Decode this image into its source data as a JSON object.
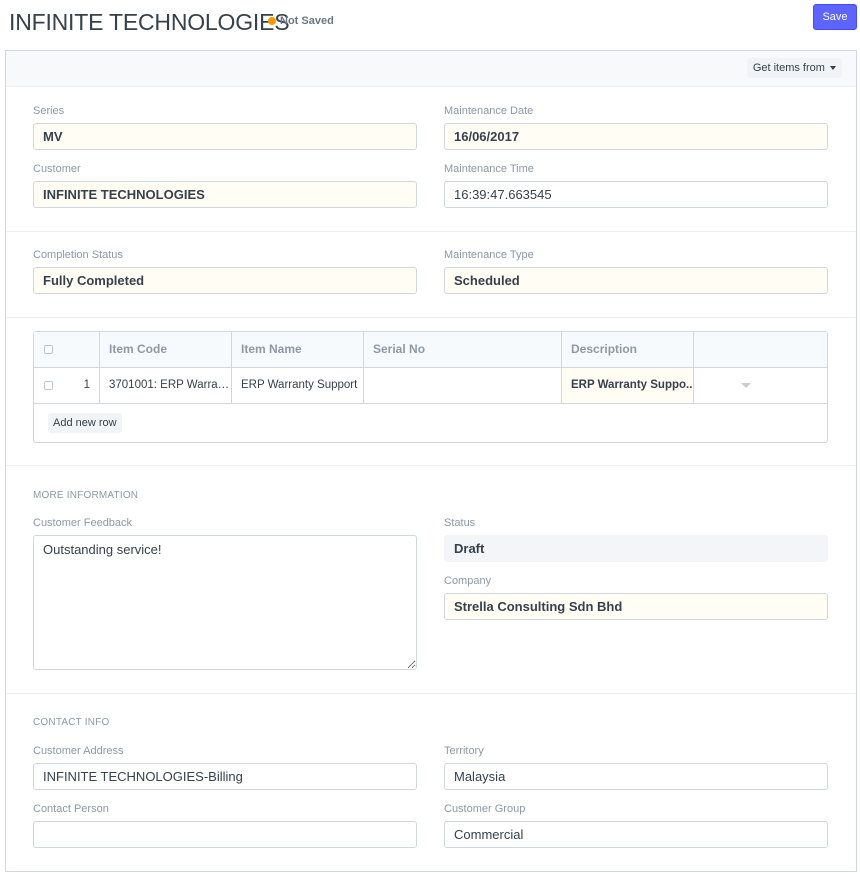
{
  "header": {
    "title": "INFINITE TECHNOLOGIES",
    "status_indicator": "Not Saved",
    "indicator_color": "#ff9800",
    "save_label": "Save",
    "accent_color": "#5e64ff"
  },
  "toolbar": {
    "get_items_label": "Get items from"
  },
  "details": {
    "series_label": "Series",
    "series_value": "MV",
    "maintenance_date_label": "Maintenance Date",
    "maintenance_date_value": "16/06/2017",
    "customer_label": "Customer",
    "customer_value": "INFINITE TECHNOLOGIES",
    "maintenance_time_label": "Maintenance Time",
    "maintenance_time_value": "16:39:47.663545",
    "completion_status_label": "Completion Status",
    "completion_status_value": "Fully Completed",
    "maintenance_type_label": "Maintenance Type",
    "maintenance_type_value": "Scheduled"
  },
  "items_table": {
    "columns": [
      "Item Code",
      "Item Name",
      "Serial No",
      "Description"
    ],
    "rows": [
      {
        "idx": "1",
        "item_code": "3701001: ERP Warrant...",
        "item_name": "ERP Warranty Support",
        "serial_no": "",
        "description": "ERP Warranty Suppo.."
      }
    ],
    "add_row_label": "Add new row"
  },
  "more_info": {
    "section_title": "MORE INFORMATION",
    "feedback_label": "Customer Feedback",
    "feedback_value": "Outstanding service!",
    "status_label": "Status",
    "status_value": "Draft",
    "company_label": "Company",
    "company_value": "Strella Consulting Sdn Bhd"
  },
  "contact_info": {
    "section_title": "CONTACT INFO",
    "customer_address_label": "Customer Address",
    "customer_address_value": "INFINITE TECHNOLOGIES-Billing",
    "territory_label": "Territory",
    "territory_value": "Malaysia",
    "contact_person_label": "Contact Person",
    "contact_person_value": "",
    "customer_group_label": "Customer Group",
    "customer_group_value": "Commercial"
  }
}
